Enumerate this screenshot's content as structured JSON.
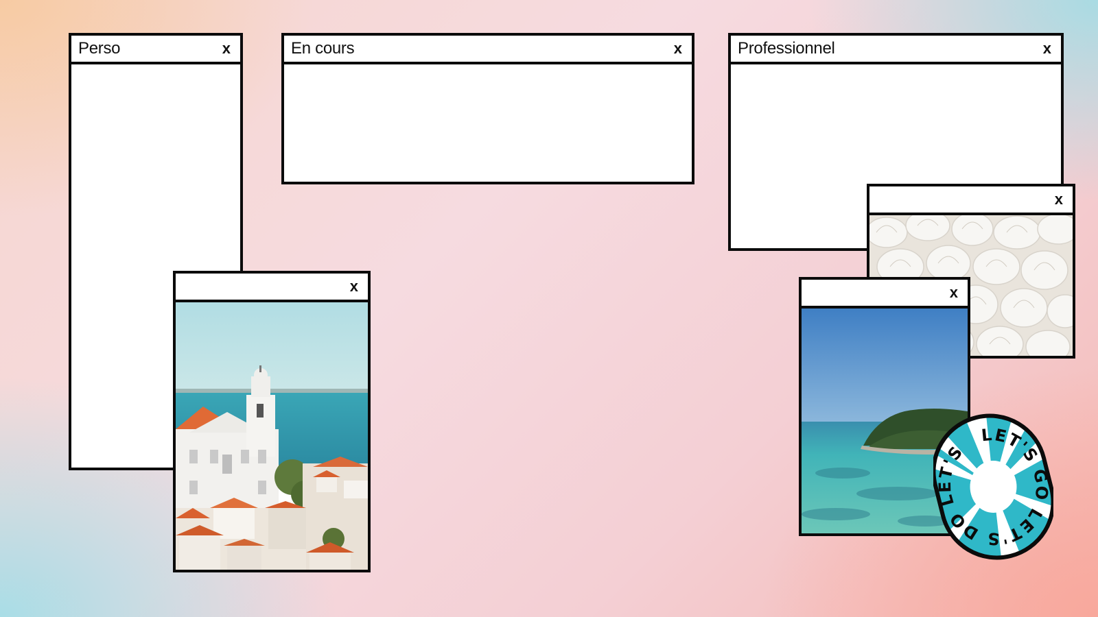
{
  "windows": {
    "perso": {
      "title": "Perso",
      "close": "x"
    },
    "en_cours": {
      "title": "En cours",
      "close": "x"
    },
    "professionnel": {
      "title": "Professionnel",
      "close": "x"
    },
    "lisbon_photo": {
      "title": "",
      "close": "x"
    },
    "shells_photo": {
      "title": "",
      "close": "x"
    },
    "island_photo": {
      "title": "",
      "close": "x"
    }
  },
  "sticker": {
    "text": "LET'S GO LET'S DO LET'S ",
    "color": "#2fb8c8"
  },
  "colors": {
    "border": "#0b0b0b",
    "window_bg": "#ffffff"
  }
}
